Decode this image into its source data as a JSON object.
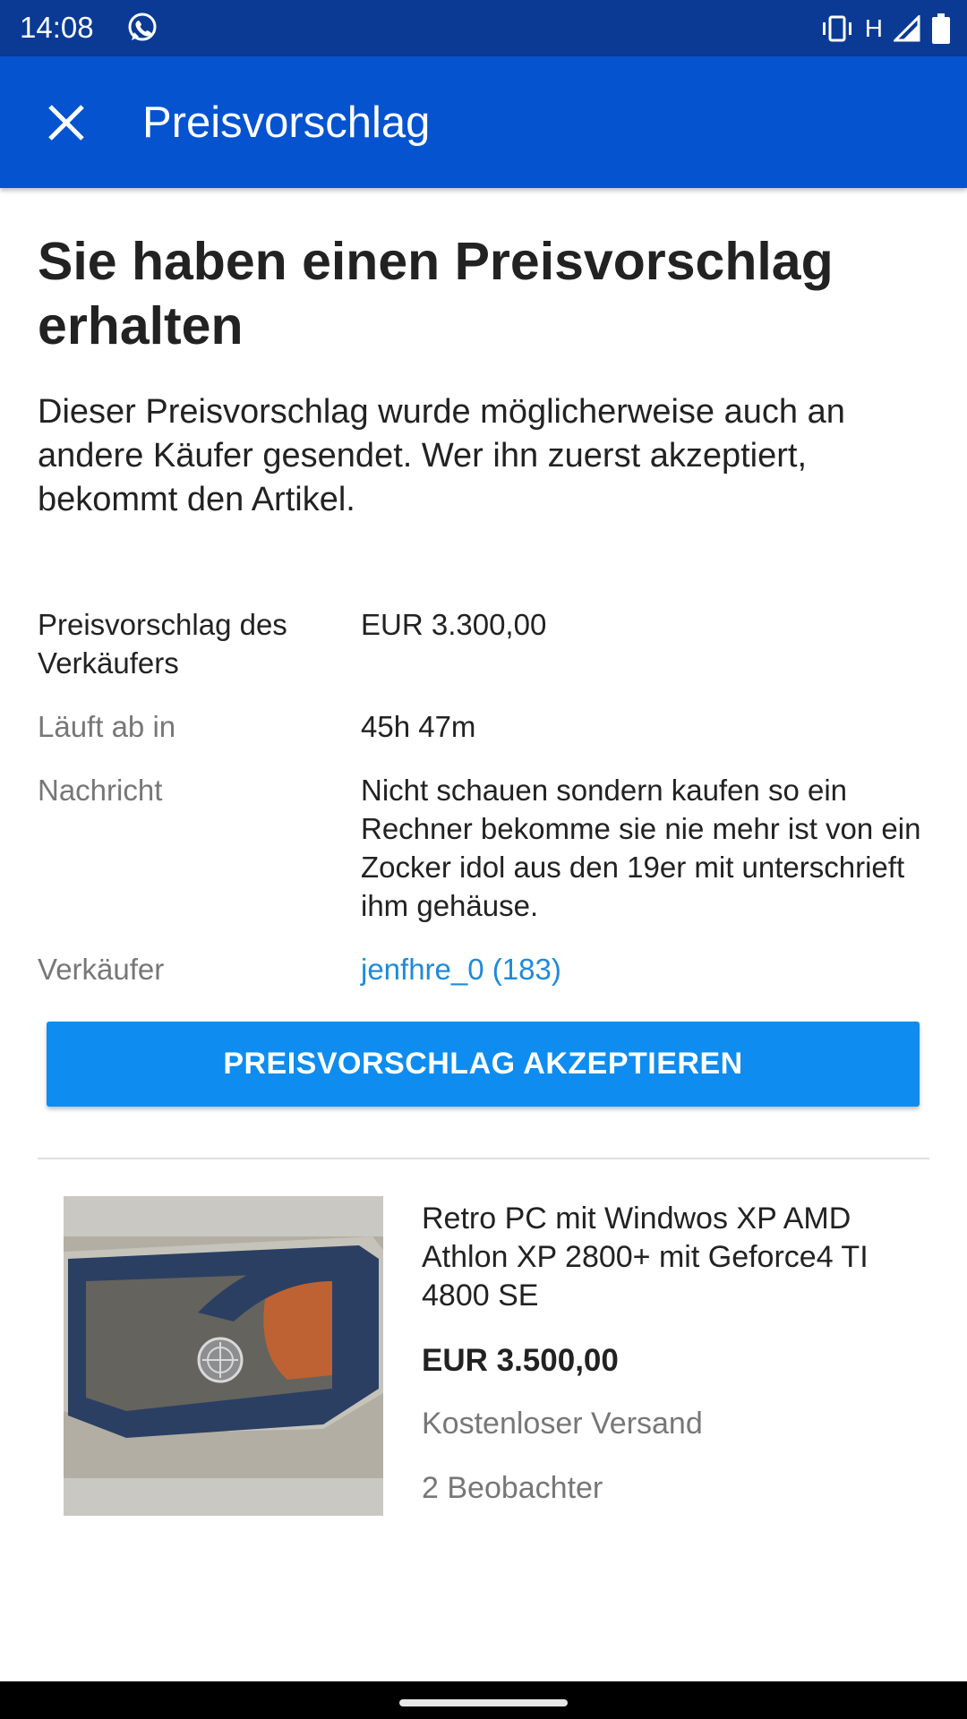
{
  "status_bar": {
    "time": "14:08",
    "network": "H",
    "icons": [
      "whatsapp-icon",
      "vibrate-icon",
      "signal-icon",
      "battery-icon"
    ]
  },
  "app_bar": {
    "title": "Preisvorschlag",
    "close_icon": "close-icon",
    "color": "#0553cf"
  },
  "offer": {
    "headline": "Sie haben einen Preisvorschlag erhalten",
    "description": "Dieser Preisvorschlag wurde möglicherweise auch an andere Käufer gesendet. Wer ihn zuerst akzeptiert, bekommt den Artikel.",
    "details": {
      "price_label": "Preisvorschlag des Verkäufers",
      "price_value": "EUR 3.300,00",
      "expires_label": "Läuft ab in",
      "expires_value": "45h 47m",
      "message_label": "Nachricht",
      "message_value": "Nicht schauen sondern kaufen so ein Rechner bekomme sie nie mehr ist von ein Zocker idol aus den 19er mit unterschrieft ihm gehäuse.",
      "seller_label": "Verkäufer",
      "seller_value": "jenfhre_0 (183)"
    },
    "accept_button": "PREISVORSCHLAG AKZEPTIEREN",
    "accent_color": "#0e8cf0"
  },
  "item": {
    "title": "Retro PC mit Windwos XP AMD Athlon XP 2800+ mit Geforce4 TI 4800 SE",
    "price": "EUR 3.500,00",
    "shipping": "Kostenloser Versand",
    "watchers": "2 Beobachter"
  }
}
